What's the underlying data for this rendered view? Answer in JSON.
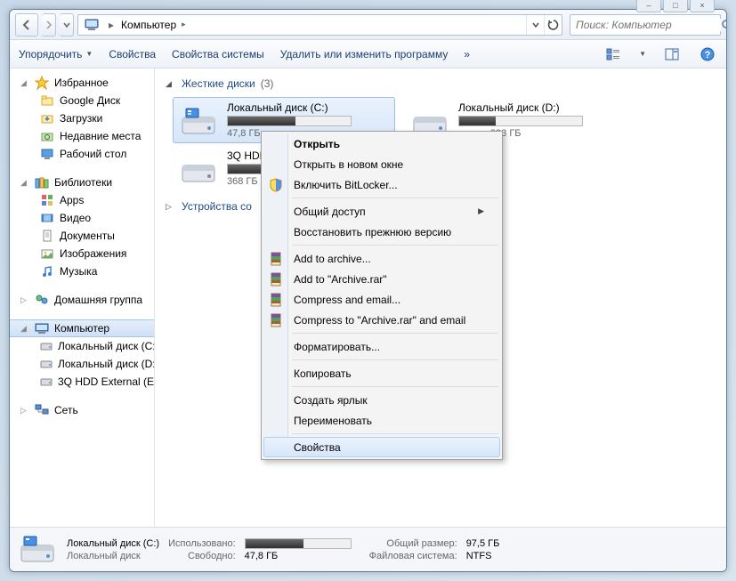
{
  "window_controls": {
    "min": "–",
    "max": "□",
    "close": "×"
  },
  "nav": {
    "breadcrumb": "Компьютер",
    "search_placeholder": "Поиск: Компьютер"
  },
  "toolbar": {
    "organize": "Упорядочить",
    "properties": "Свойства",
    "system_properties": "Свойства системы",
    "uninstall": "Удалить или изменить программу",
    "more": "»"
  },
  "sidebar": {
    "favorites": {
      "head": "Избранное",
      "items": [
        "Google Диск",
        "Загрузки",
        "Недавние места",
        "Рабочий стол"
      ]
    },
    "libraries": {
      "head": "Библиотеки",
      "items": [
        "Apps",
        "Видео",
        "Документы",
        "Изображения",
        "Музыка"
      ]
    },
    "homegroup": {
      "head": "Домашняя группа"
    },
    "computer": {
      "head": "Компьютер",
      "items": [
        "Локальный диск (C:)",
        "Локальный диск (D:)",
        "3Q HDD External (E:)"
      ]
    },
    "network": {
      "head": "Сеть"
    }
  },
  "content": {
    "cat_hdd": "Жесткие диски",
    "cat_hdd_count": "(3)",
    "cat_removable": "Устройства со",
    "drives": [
      {
        "name": "Локальный диск (C:)",
        "free": "47,8 ГБ с",
        "fill": 55
      },
      {
        "name": "Локальный диск (D:)",
        "free": "дно из 833 ГБ",
        "fill": 30
      },
      {
        "name": "3Q HDD ",
        "free": "368 ГБ с",
        "fill": 65
      }
    ]
  },
  "context_menu": {
    "items": [
      {
        "label": "Открыть",
        "bold": true
      },
      {
        "label": "Открыть в новом окне"
      },
      {
        "label": "Включить BitLocker...",
        "icon": "shield"
      },
      {
        "sep": true
      },
      {
        "label": "Общий доступ",
        "submenu": true
      },
      {
        "label": "Восстановить прежнюю версию"
      },
      {
        "sep": true
      },
      {
        "label": "Add to archive...",
        "icon": "rar"
      },
      {
        "label": "Add to \"Archive.rar\"",
        "icon": "rar"
      },
      {
        "label": "Compress and email...",
        "icon": "rar"
      },
      {
        "label": "Compress to \"Archive.rar\" and email",
        "icon": "rar"
      },
      {
        "sep": true
      },
      {
        "label": "Форматировать..."
      },
      {
        "sep": true
      },
      {
        "label": "Копировать"
      },
      {
        "sep": true
      },
      {
        "label": "Создать ярлык"
      },
      {
        "label": "Переименовать"
      },
      {
        "sep": true
      },
      {
        "label": "Свойства",
        "hl": true
      }
    ]
  },
  "status": {
    "name": "Локальный диск (C:)",
    "used_lbl": "Использовано:",
    "used_fill": 55,
    "total_lbl": "Общий размер:",
    "total": "97,5 ГБ",
    "free_lbl": "Свободно:",
    "free": "47,8 ГБ",
    "fs_lbl": "Файловая система:",
    "fs": "NTFS"
  }
}
